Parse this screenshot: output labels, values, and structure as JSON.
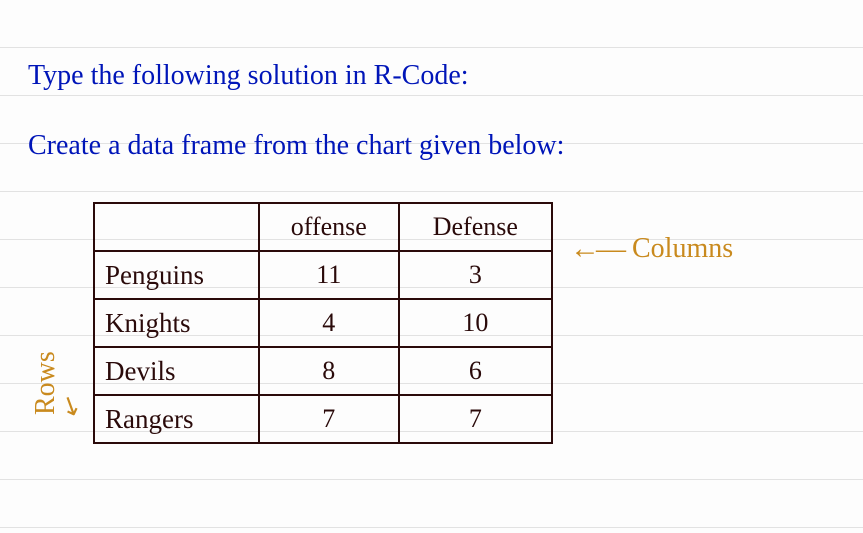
{
  "prompt": {
    "line1": "Type the following solution in R-Code:",
    "line2": "Create a data frame from the chart given below:"
  },
  "annotations": {
    "columns_label": "Columns",
    "rows_label": "Rows",
    "left_arrow": "←—",
    "curve_arrow": "↘"
  },
  "chart_data": {
    "type": "table",
    "title": "",
    "columns": [
      "offense",
      "Defense"
    ],
    "rows": [
      "Penguins",
      "Knights",
      "Devils",
      "Rangers"
    ],
    "values": [
      [
        11,
        3
      ],
      [
        4,
        10
      ],
      [
        8,
        6
      ],
      [
        7,
        7
      ]
    ]
  }
}
